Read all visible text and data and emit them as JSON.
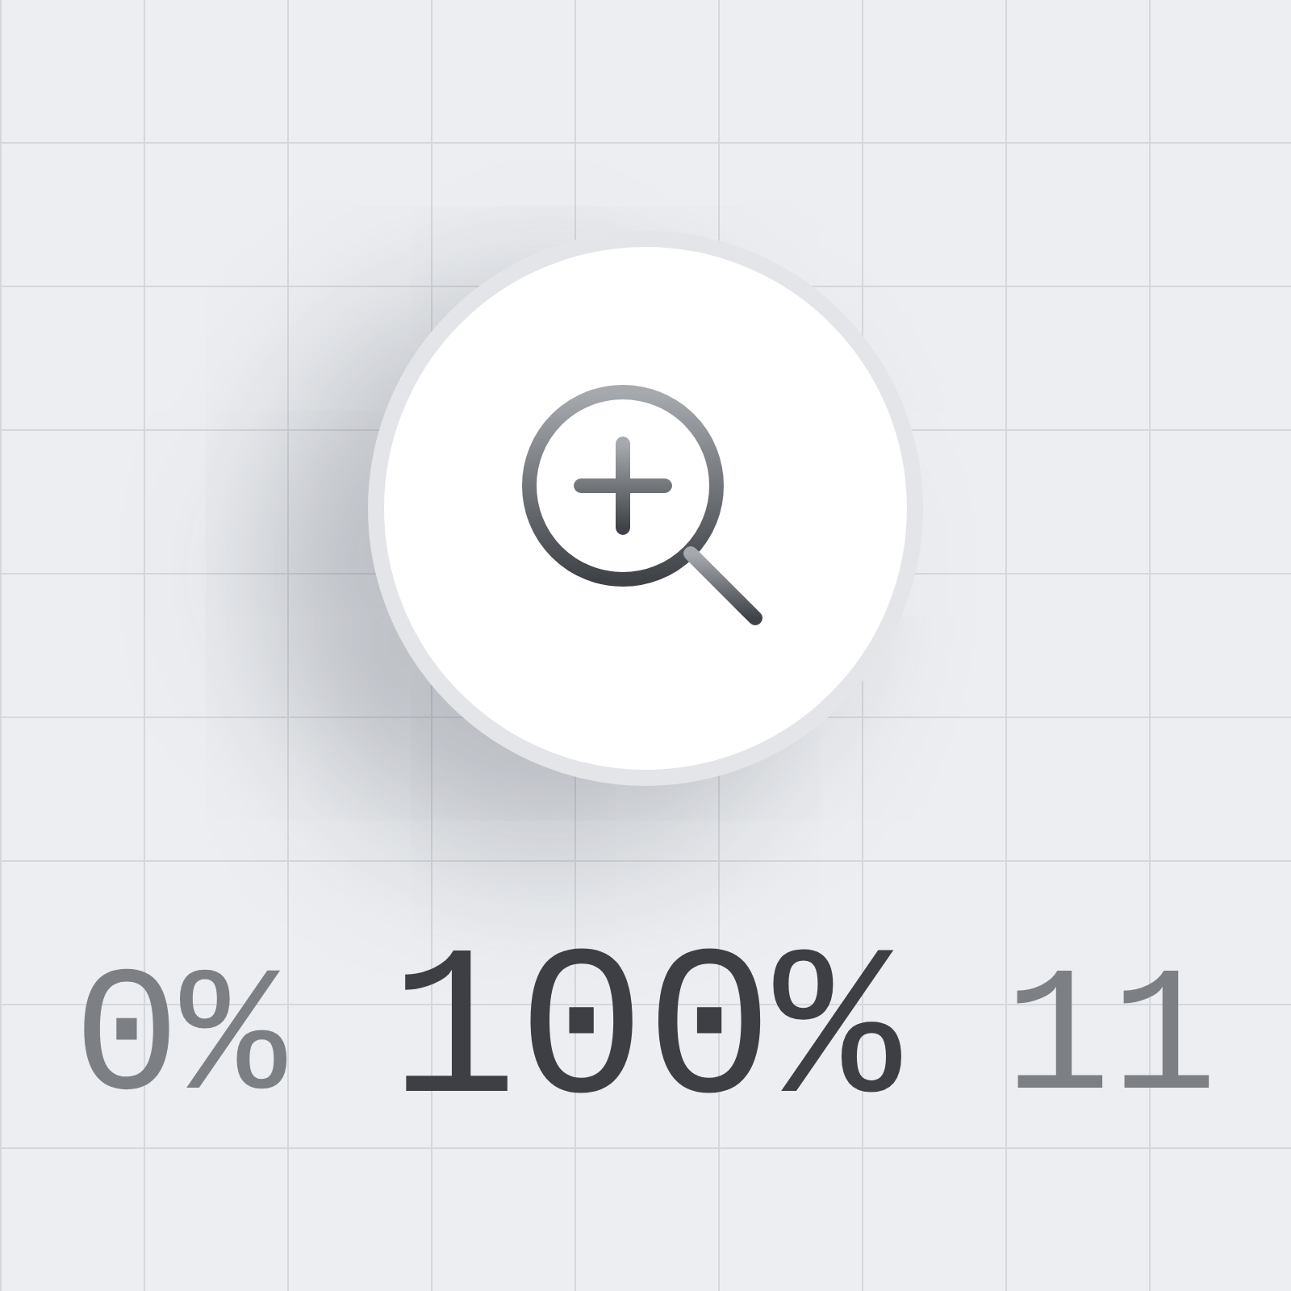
{
  "zoom_button": {
    "kind": "zoom-in"
  },
  "zoom_levels": [
    {
      "text": "0%",
      "selected": false
    },
    {
      "text": "100%",
      "selected": true
    },
    {
      "text": "11",
      "selected": false
    }
  ]
}
